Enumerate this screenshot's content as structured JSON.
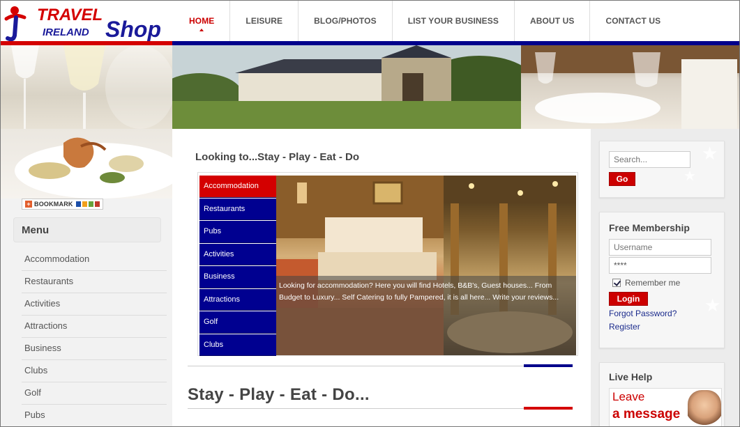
{
  "logo": {
    "line1": "TRAVEL",
    "line2": "IRELAND",
    "line3": "Shop"
  },
  "nav": {
    "items": [
      {
        "label": "HOME",
        "active": true
      },
      {
        "label": "LEISURE"
      },
      {
        "label": "BLOG/PHOTOS"
      },
      {
        "label": "LIST YOUR BUSINESS"
      },
      {
        "label": "ABOUT US"
      },
      {
        "label": "CONTACT US"
      }
    ]
  },
  "bookmark": {
    "label": "BOOKMARK"
  },
  "sidebar": {
    "title": "Menu",
    "items": [
      {
        "label": "Accommodation"
      },
      {
        "label": "Restaurants"
      },
      {
        "label": "Activities"
      },
      {
        "label": "Attractions"
      },
      {
        "label": "Business"
      },
      {
        "label": "Clubs"
      },
      {
        "label": "Golf"
      },
      {
        "label": "Pubs"
      }
    ]
  },
  "main": {
    "heading": "Looking to...Stay - Play - Eat - Do",
    "tabs": [
      {
        "label": "Accommodation",
        "active": true
      },
      {
        "label": "Restaurants"
      },
      {
        "label": "Pubs"
      },
      {
        "label": "Activities"
      },
      {
        "label": "Business"
      },
      {
        "label": "Attractions"
      },
      {
        "label": "Golf"
      },
      {
        "label": "Clubs"
      }
    ],
    "caption": "Looking for accommodation? Here you will find Hotels, B&B's, Guest houses... From Budget to Luxury... Self Catering to fully Pampered, it is all here... Write your reviews...",
    "section_title": "Stay - Play - Eat - Do..."
  },
  "search": {
    "placeholder": "Search...",
    "button": "Go"
  },
  "membership": {
    "title": "Free Membership",
    "username_placeholder": "Username",
    "password_value": "****",
    "remember_label": "Remember me",
    "login_button": "Login",
    "forgot_link": "Forgot Password?",
    "register_link": "Register"
  },
  "live_help": {
    "title": "Live Help",
    "line1": "Leave",
    "line2": "a message"
  },
  "colors": {
    "brand_red": "#cc0000",
    "brand_blue": "#000090",
    "nav_blue": "#00008b"
  }
}
